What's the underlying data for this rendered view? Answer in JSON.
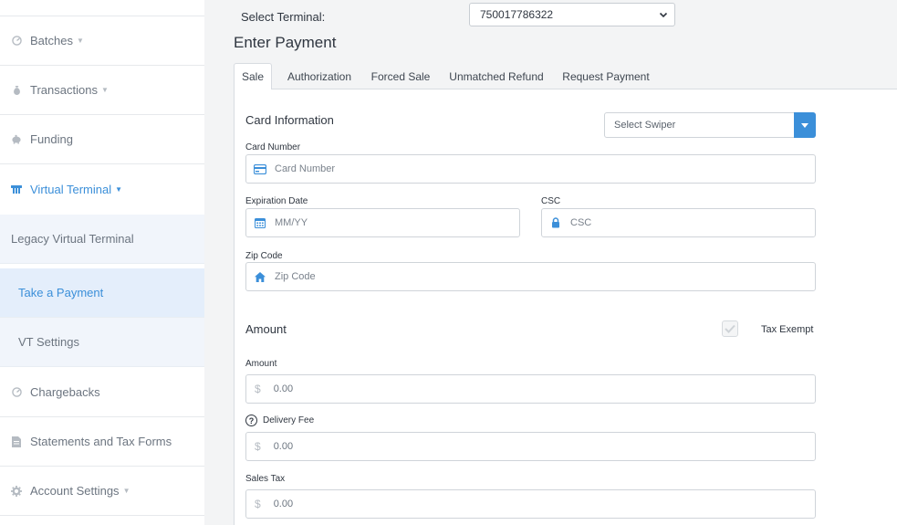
{
  "sidebar": {
    "items": [
      {
        "label": "Batches",
        "icon": "dashboard-icon",
        "has_caret": true
      },
      {
        "label": "Transactions",
        "icon": "money-bag-icon",
        "has_caret": true
      },
      {
        "label": "Funding",
        "icon": "piggy-bank-icon",
        "has_caret": false
      },
      {
        "label": "Virtual Terminal",
        "icon": "terminal-icon",
        "has_caret": true,
        "active": true
      },
      {
        "label": "Chargebacks",
        "icon": "dashboard-icon",
        "has_caret": false
      },
      {
        "label": "Statements and Tax Forms",
        "icon": "document-icon",
        "has_caret": false
      },
      {
        "label": "Account Settings",
        "icon": "gear-icon",
        "has_caret": true
      }
    ],
    "sub_items": [
      {
        "label": "Legacy Virtual Terminal"
      },
      {
        "label": "Take a Payment",
        "selected": true
      },
      {
        "label": "VT Settings"
      }
    ]
  },
  "header": {
    "terminal_label": "Select Terminal:",
    "terminal_value": "750017786322",
    "page_title": "Enter Payment"
  },
  "tabs": [
    {
      "label": "Sale",
      "active": true
    },
    {
      "label": "Authorization"
    },
    {
      "label": "Forced Sale"
    },
    {
      "label": "Unmatched Refund"
    },
    {
      "label": "Request Payment"
    }
  ],
  "card": {
    "section_title": "Card Information",
    "swiper_placeholder": "Select Swiper",
    "card_number_label": "Card Number",
    "card_number_placeholder": "Card Number",
    "expiration_label": "Expiration Date",
    "expiration_placeholder": "MM/YY",
    "csc_label": "CSC",
    "csc_placeholder": "CSC",
    "zip_label": "Zip Code",
    "zip_placeholder": "Zip Code"
  },
  "amount": {
    "section_title": "Amount",
    "tax_exempt_label": "Tax Exempt",
    "tax_exempt_checked": true,
    "amount_label": "Amount",
    "amount_value": "0.00",
    "delivery_fee_label": "Delivery Fee",
    "delivery_fee_value": "0.00",
    "sales_tax_label": "Sales Tax",
    "sales_tax_value": "0.00",
    "currency_symbol": "$"
  },
  "colors": {
    "accent": "#3b8fd9",
    "sidebar_selected_bg": "#e4eefb",
    "sidebar_sub_bg": "#f1f5fb"
  }
}
